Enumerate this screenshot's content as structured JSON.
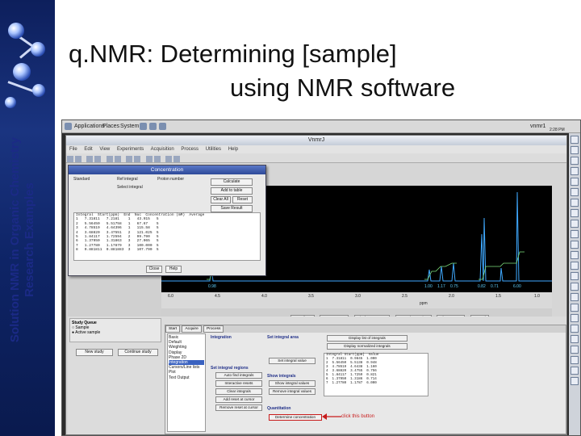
{
  "slide": {
    "title_line1": "q.NMR: Determining [sample]",
    "title_line2": "using NMR software",
    "side_line1": "Solution NMR in Organic Chemistry",
    "side_line2": "Research Examples"
  },
  "desktop": {
    "menus": [
      "Applications",
      "Places",
      "System"
    ],
    "user": "vnmr1",
    "time": "2:28 PM"
  },
  "vnmrj": {
    "window_title": "VnmrJ",
    "menu": [
      "File",
      "Edit",
      "View",
      "Experiments",
      "Acquisition",
      "Process",
      "Utilities",
      "Help"
    ],
    "dialog": {
      "title": "Concentration",
      "labels": [
        "Standard",
        "Ref integral",
        "Proton number",
        "Select integral"
      ],
      "buttons": [
        "Calculate",
        "Add to table",
        "Clear All",
        "Reset",
        "Save Result"
      ],
      "table_header": "Integral  Start(ppm)  End  Nuc  Concentration (mM)  Average",
      "table_rows": [
        "1   7.31811   7.2181    1   43.915   5",
        "2   5.56450   5.51758   1   67.67    5",
        "3   4.78519   4.64396   1   115.58   5",
        "4   3.68820   3.47551   2   121.025  5",
        "5   1.84117   1.72594   2   99.790   5",
        "6   1.37950   1.31863   3   27.065   5",
        "7   1.27780   1.17879   3   100.000  5",
        "8   0.881811  0.881883  3   107.790  5"
      ],
      "close": "Close",
      "help": "Help"
    },
    "peak_values": [
      "0.98",
      "1.00",
      "1.17",
      "0.75",
      "0.82",
      "0.71",
      "6.00"
    ],
    "axis_ticks": [
      "6.0",
      "4.5",
      "4.0",
      "3.5",
      "3.0",
      "2.5",
      "2.0",
      "1.5",
      "1.0"
    ],
    "axis_unit": "ppm",
    "tabs": [
      "Transform",
      "Auto process",
      "Display spectrum",
      "Auto plot preview",
      "Clear screen",
      "Cancel"
    ],
    "sample": {
      "header": "Study Queue",
      "options": [
        "Sample",
        "Active sample",
        "Study queue"
      ],
      "new_study": "New study",
      "continue_study": "Continue study"
    },
    "process": {
      "tabs": [
        "Start",
        "Acquire",
        "Process"
      ],
      "list": [
        "Basic",
        "Default",
        "Weighting",
        "Display",
        "Phase 2D",
        "Integration",
        "Cursors/Line lists",
        "Plot",
        "Text Output"
      ],
      "selected": "Integration",
      "groups": [
        "Integration",
        "Set integral area",
        "Set integral regions",
        "Show integrals",
        "Quantitation"
      ],
      "buttons": [
        "Auto find integrals",
        "Interactive resets",
        "Clear integrals",
        "Add reset at cursor",
        "Remove reset at cursor",
        "Show integral values",
        "Remove integral values",
        "Set integral value",
        "Display list of integrals",
        "Display normalized integrals",
        "Determine concentration"
      ],
      "int_header": "Integral Start(ppm)  Value",
      "int_rows": [
        "1  7.31811  0.9845  1.000",
        "2  5.56450  5.5138  0.948",
        "3  4.78519  4.6438  1.160",
        "4  3.68820  3.4755  0.756",
        "5  1.84117  1.7259  0.821",
        "6  1.37950  1.3186  0.714",
        "7  1.27780  1.1787  6.000"
      ]
    },
    "annotation": "click this button"
  }
}
